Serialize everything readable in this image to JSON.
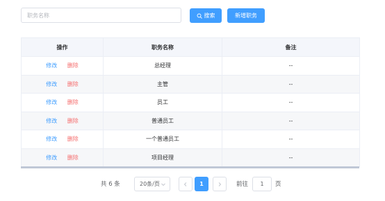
{
  "search": {
    "placeholder": "职务名称",
    "value": ""
  },
  "toolbar": {
    "search_label": "搜索",
    "add_label": "新增职务",
    "search_icon": "search-icon"
  },
  "table": {
    "headers": [
      "操作",
      "职务名称",
      "备注"
    ],
    "actions": {
      "edit": "修改",
      "delete": "删除"
    },
    "rows": [
      {
        "name": "总经理",
        "note": "--"
      },
      {
        "name": "主管",
        "note": "--"
      },
      {
        "name": "员工",
        "note": "--"
      },
      {
        "name": "普通员工",
        "note": "--"
      },
      {
        "name": "一个普通员工",
        "note": "--"
      },
      {
        "name": "项目经理",
        "note": "--"
      }
    ]
  },
  "pagination": {
    "total_text": "共 6 条",
    "page_size": "20条/页",
    "prev_icon": "chevron-left-icon",
    "next_icon": "chevron-right-icon",
    "current_page": "1",
    "goto_label": "前往",
    "goto_value": "1",
    "goto_unit": "页"
  },
  "colors": {
    "primary": "#409eff",
    "danger": "#f56c6c",
    "header_bg": "#f4f6fb"
  }
}
